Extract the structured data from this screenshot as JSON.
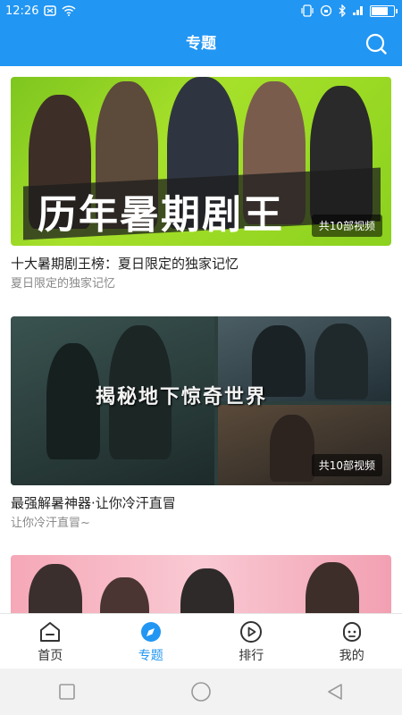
{
  "status_bar": {
    "time": "12:26"
  },
  "app_bar": {
    "title": "专题"
  },
  "cards": [
    {
      "banner_text": "历年暑期剧王",
      "badge": "共10部视频",
      "title": "十大暑期剧王榜：夏日限定的独家记忆",
      "subtitle": "夏日限定的独家记忆"
    },
    {
      "banner_text": "揭秘地下惊奇世界",
      "badge": "共10部视频",
      "title": "最强解暑神器·让你冷汗直冒",
      "subtitle": "让你冷汗直冒~"
    },
    {
      "banner_text": "",
      "badge": "",
      "title": "",
      "subtitle": ""
    }
  ],
  "bottom_nav": [
    {
      "label": "首页",
      "icon": "home-icon",
      "active": false
    },
    {
      "label": "专题",
      "icon": "compass-icon",
      "active": true
    },
    {
      "label": "排行",
      "icon": "play-icon",
      "active": false
    },
    {
      "label": "我的",
      "icon": "face-icon",
      "active": false
    }
  ],
  "colors": {
    "primary": "#2196f3",
    "text": "#222222",
    "subtext": "#888888"
  }
}
